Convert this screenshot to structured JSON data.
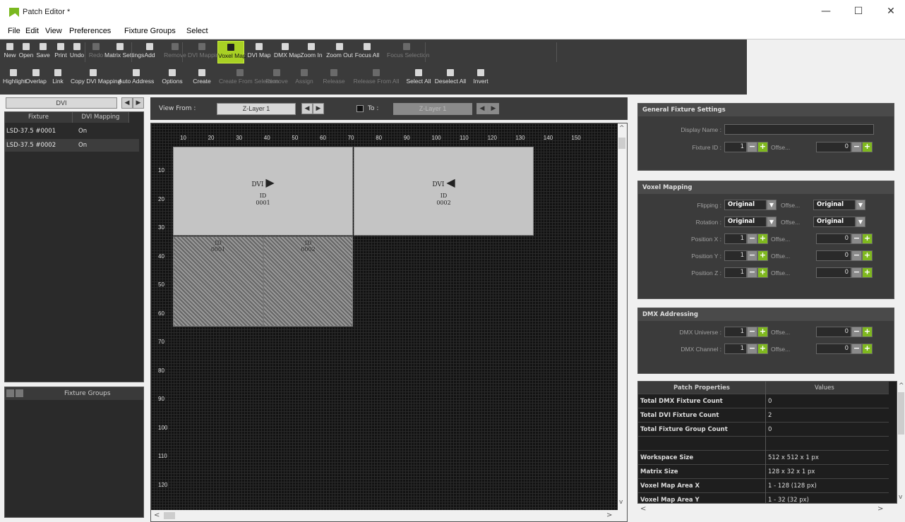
{
  "window": {
    "title": "Patch Editor *",
    "minimize": "—",
    "maximize": "☐",
    "close": "✕"
  },
  "menu": [
    "File",
    "Edit",
    "View",
    "Preferences",
    "Fixture Groups",
    "Select"
  ],
  "toolbar": {
    "row1": [
      {
        "label": "New",
        "state": "normal"
      },
      {
        "label": "Open",
        "state": "normal"
      },
      {
        "label": "Save",
        "state": "normal"
      },
      {
        "label": "Print",
        "state": "normal"
      },
      {
        "label": "Undo",
        "state": "normal"
      },
      {
        "label": "Redo",
        "state": "disabled"
      },
      {
        "label": "Matrix Settings",
        "state": "normal"
      },
      {
        "label": "Add",
        "state": "normal"
      },
      {
        "label": "Remove",
        "state": "disabled"
      },
      {
        "label": "DVI Mapping Defaults",
        "state": "disabled"
      },
      {
        "label": "Voxel Map",
        "state": "active"
      },
      {
        "label": "DVI Map",
        "state": "normal"
      },
      {
        "label": "DMX Map",
        "state": "normal"
      },
      {
        "label": "Zoom In",
        "state": "normal"
      },
      {
        "label": "Zoom Out",
        "state": "normal"
      },
      {
        "label": "Focus All",
        "state": "normal"
      },
      {
        "label": "Focus Selection",
        "state": "disabled"
      }
    ],
    "row2": [
      {
        "label": "Highlight",
        "state": "normal"
      },
      {
        "label": "Overlap",
        "state": "normal"
      },
      {
        "label": "Link",
        "state": "normal"
      },
      {
        "label": "Copy DVI Mapping",
        "state": "normal"
      },
      {
        "label": "Auto Address",
        "state": "normal"
      },
      {
        "label": "Options",
        "state": "normal"
      },
      {
        "label": "Create",
        "state": "normal"
      },
      {
        "label": "Create From Selection",
        "state": "disabled"
      },
      {
        "label": "Remove",
        "state": "disabled"
      },
      {
        "label": "Assign",
        "state": "disabled"
      },
      {
        "label": "Release",
        "state": "disabled"
      },
      {
        "label": "Release From All",
        "state": "disabled"
      },
      {
        "label": "Select All",
        "state": "normal"
      },
      {
        "label": "Deselect All",
        "state": "normal"
      },
      {
        "label": "Invert",
        "state": "normal"
      }
    ]
  },
  "left": {
    "selector": "DVI",
    "columns": [
      "Fixture",
      "DVI Mapping"
    ],
    "rows": [
      {
        "fixture": "LSD-37.5 #0001",
        "mapping": "On"
      },
      {
        "fixture": "LSD-37.5 #0002",
        "mapping": "On"
      }
    ],
    "groups_title": "Fixture Groups"
  },
  "view": {
    "view_from_label": "View From :",
    "from_layer": "Z-Layer 1",
    "to_label": "To :",
    "to_layer": "Z-Layer 1",
    "x_ticks": [
      "10",
      "20",
      "30",
      "40",
      "50",
      "60",
      "70",
      "80",
      "90",
      "100",
      "110",
      "120",
      "130",
      "140",
      "150"
    ],
    "y_ticks": [
      "10",
      "20",
      "30",
      "40",
      "50",
      "60",
      "70",
      "80",
      "90",
      "100",
      "110",
      "120"
    ],
    "fixtures": [
      {
        "type": "DVI",
        "arrow": "▶",
        "id_label": "ID",
        "id": "0001"
      },
      {
        "type": "DVI",
        "arrow": "◀",
        "id_label": "ID",
        "id": "0002"
      }
    ],
    "shadows": [
      {
        "id_label": "ID",
        "id": "0001"
      },
      {
        "id_label": "ID",
        "id": "0002"
      }
    ],
    "scroll_up": "^",
    "scroll_down": "v",
    "scroll_left": "<",
    "scroll_right": ">"
  },
  "general": {
    "title": "General Fixture Settings",
    "display_name_label": "Display Name :",
    "display_name": "",
    "fixture_id_label": "Fixture ID :",
    "fixture_id": "1",
    "offset_label": "Offse...",
    "offset": "0"
  },
  "voxel": {
    "title": "Voxel Mapping",
    "flipping_label": "Flipping :",
    "flipping": "Original",
    "flip_offset": "Original",
    "rotation_label": "Rotation :",
    "rotation": "Original",
    "rot_offset": "Original",
    "posx_label": "Position X :",
    "posx": "1",
    "posx_off": "0",
    "posy_label": "Position Y :",
    "posy": "1",
    "posy_off": "0",
    "posz_label": "Position Z :",
    "posz": "1",
    "posz_off": "0",
    "offset_label": "Offse..."
  },
  "dmx": {
    "title": "DMX Addressing",
    "universe_label": "DMX Universe :",
    "universe": "1",
    "universe_off": "0",
    "channel_label": "DMX Channel :",
    "channel": "1",
    "channel_off": "0",
    "offset_label": "Offse..."
  },
  "props": {
    "col_property": "Patch Properties",
    "col_value": "Values",
    "rows": [
      {
        "k": "Total DMX Fixture Count",
        "v": "0"
      },
      {
        "k": "Total DVI Fixture Count",
        "v": "2"
      },
      {
        "k": "Total Fixture Group Count",
        "v": "0"
      },
      {
        "k": "",
        "v": ""
      },
      {
        "k": "Workspace Size",
        "v": "512 x 512 x 1 px"
      },
      {
        "k": "Matrix Size",
        "v": "128 x 32 x 1 px"
      },
      {
        "k": "Voxel Map Area X",
        "v": "1 - 128 (128 px)"
      },
      {
        "k": "Voxel Map Area Y",
        "v": "1 - 32 (32 px)"
      }
    ]
  }
}
